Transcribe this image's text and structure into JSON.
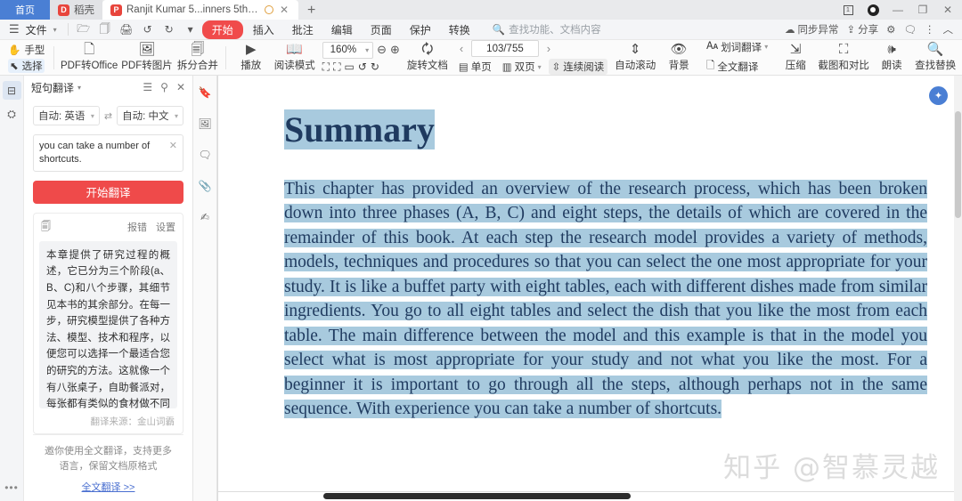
{
  "titlebar": {
    "tabs": [
      {
        "label": "首页",
        "type": "home"
      },
      {
        "label": "稻壳",
        "type": "inactive",
        "icon": "D"
      },
      {
        "label": "Ranjit Kumar 5...inners 5th.pdf",
        "type": "active",
        "icon": "P"
      }
    ],
    "new_tab": "+",
    "window": {
      "restore": "1",
      "record": "",
      "minimize": "—",
      "maximize": "❐",
      "close": "✕"
    }
  },
  "menubar": {
    "file": "文件",
    "items": [
      {
        "label": "开始",
        "active": true
      },
      {
        "label": "插入",
        "active": false
      },
      {
        "label": "批注",
        "active": false
      },
      {
        "label": "编辑",
        "active": false
      },
      {
        "label": "页面",
        "active": false
      },
      {
        "label": "保护",
        "active": false
      },
      {
        "label": "转换",
        "active": false
      }
    ],
    "search_placeholder": "查找功能、文档内容",
    "right": [
      {
        "label": "同步异常",
        "icon": "cloud-warning-icon"
      },
      {
        "label": "分享",
        "icon": "share-icon"
      }
    ]
  },
  "toolbar": {
    "hand_tool": "手型",
    "select_tool": "选择",
    "pdf_to_office": "PDF转Office",
    "pdf_to_image": "PDF转图片",
    "split_merge": "拆分合并",
    "play": "播放",
    "read_mode": "阅读模式",
    "zoom_value": "160%",
    "rotate_doc": "旋转文档",
    "page_value": "103/755",
    "single_page": "单页",
    "double_page": "双页",
    "continuous_read": "连续阅读",
    "auto_scroll": "自动滚动",
    "background": "背景",
    "word_translate": "划词翻译",
    "full_translate": "全文翻译",
    "compress": "压缩",
    "screenshot_compare": "截图和对比",
    "read_aloud": "朗读",
    "find_replace": "查找替换"
  },
  "translate_panel": {
    "title": "短句翻译",
    "source_lang": "自动: 英语",
    "target_lang": "自动: 中文",
    "source_text": "you can take a number of shortcuts.",
    "translate_button": "开始翻译",
    "report_error": "报错",
    "settings": "设置",
    "result_text": "本章提供了研究过程的概述，它已分为三个阶段(a、B、C)和八个步骤，其细节见本书的其余部分。在每一步，研究模型提供了各种方法、模型、技术和程序，以便您可以选择一个最适合您的研究的方法。这就像一个有八张桌子，自助餐派对，每张都有类似的食材做不同的菜着。你去所有的八张桌子，从每张桌子中选择你最喜欢的菜。这个模型和这个示例之间的主要区别在于，在模型中，你选择的是最适合你的学习，而不是你最喜欢的。对于一个初学者来说，完成所有的步骤是很重要的，尽管可能不是在相同的顺序中。有了经验，你可以采取许多快捷方式。",
    "result_source": "翻译来源：金山词霸",
    "promo_text": "邀你使用全文翻译，支持更多语言，保留文档原格式",
    "promo_link": "全文翻译 >>"
  },
  "side_icons": [
    {
      "name": "bookmark-icon",
      "glyph": "🔖"
    },
    {
      "name": "thumbnail-icon",
      "glyph": "🖼"
    },
    {
      "name": "comment-icon",
      "glyph": "💬"
    },
    {
      "name": "attachment-icon",
      "glyph": "📎"
    },
    {
      "name": "signature-icon",
      "glyph": "✍"
    }
  ],
  "document": {
    "title": "Summary",
    "paragraph": "This chapter has provided an overview of the research process, which has been broken down into three phases (A, B, C) and eight steps, the details of which are covered in the remainder of this book. At each step the research model provides a variety of methods, models, techniques and procedures so that you can select the one most appropriate for your study. It is like a buffet party with eight tables, each with different dishes made from similar ingredients. You go to all eight tables and select the dish that you like the most from each table. The main difference between the model and this example is that in the model you select what is most appropriate for your study and not what you like the most. For a beginner it is important to go through all the steps, although perhaps not in the same sequence. With experience you can take a number of shortcuts.",
    "watermark": "知乎 @智慕灵越"
  }
}
